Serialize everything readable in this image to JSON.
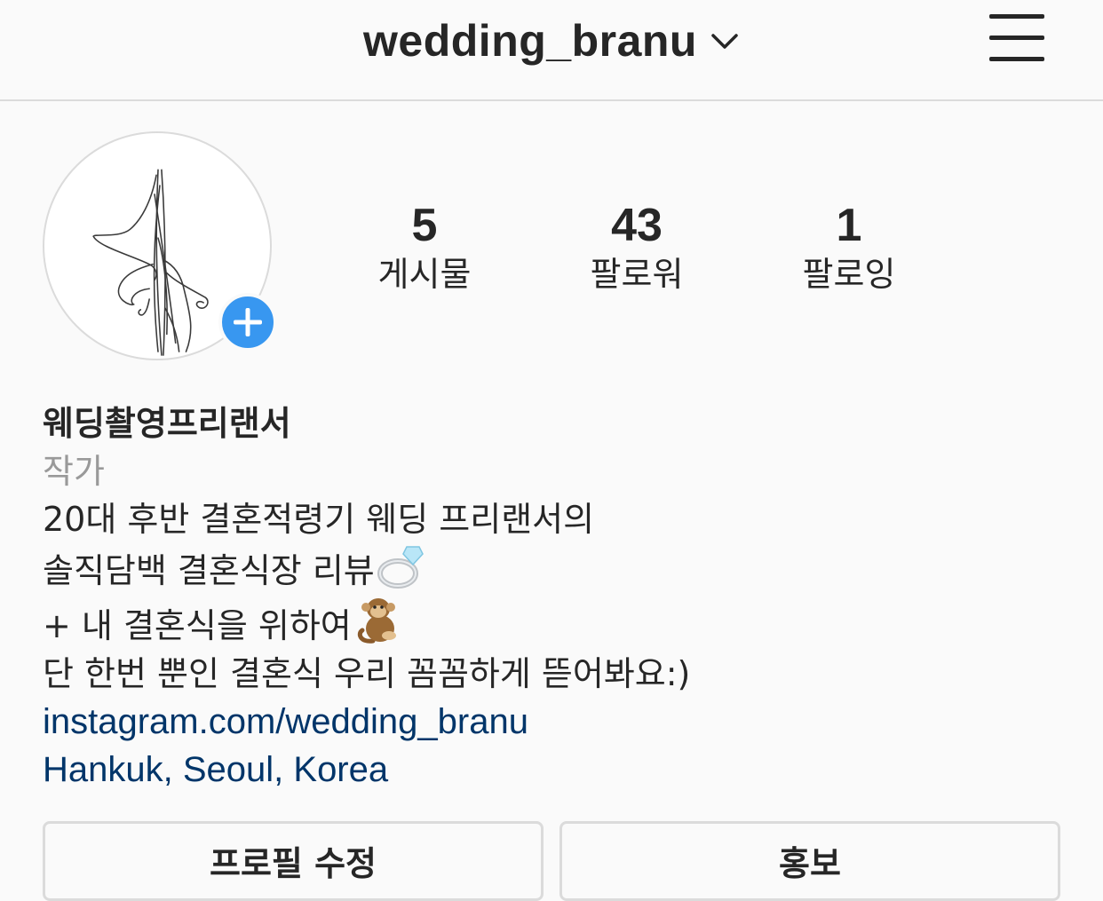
{
  "header": {
    "username": "wedding_branu",
    "chevron_icon": "chevron-down-icon",
    "menu_icon": "hamburger-menu-icon"
  },
  "profile": {
    "avatar_icon": "signature-avatar",
    "add_story_icon": "plus-icon",
    "accent_color": "#3897f0"
  },
  "stats": [
    {
      "value": "5",
      "label": "게시물"
    },
    {
      "value": "43",
      "label": "팔로워"
    },
    {
      "value": "1",
      "label": "팔로잉"
    }
  ],
  "bio": {
    "name": "웨딩촬영프리랜서",
    "category": "작가",
    "lines": [
      "20대 후반 결혼적령기 웨딩 프리랜서의",
      "솔직담백 결혼식장 리뷰",
      "+ 내 결혼식을 위하여",
      "단 한번 뿐인 결혼식 우리 꼼꼼하게 뜯어봐요:)"
    ],
    "link": "instagram.com/wedding_branu",
    "location": "Hankuk, Seoul, Korea",
    "link_color": "#003569"
  },
  "buttons": {
    "edit_profile": "프로필 수정",
    "promote": "홍보"
  }
}
